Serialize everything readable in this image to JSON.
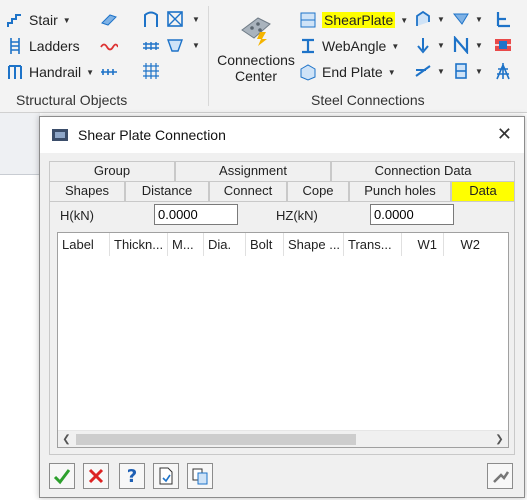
{
  "ribbon": {
    "structural_objects": {
      "label": "Structural Objects",
      "stair": "Stair",
      "ladders": "Ladders",
      "handrail": "Handrail"
    },
    "connections_center": {
      "line1": "Connections",
      "line2": "Center"
    },
    "steel_connections": {
      "label": "Steel Connections",
      "shear_plate": "ShearPlate",
      "web_angle": "WebAngle",
      "end_plate": "End Plate"
    }
  },
  "dialog": {
    "title": "Shear Plate Connection",
    "tabs_row1": [
      "Group",
      "Assignment",
      "Connection Data"
    ],
    "tabs_row2": [
      "Shapes",
      "Distance",
      "Connect",
      "Cope",
      "Punch holes",
      "Data"
    ],
    "h_label": "H(kN)",
    "h_value": "0.0000",
    "hz_label": "HZ(kN)",
    "hz_value": "0.0000",
    "columns": [
      "Label",
      "Thickn...",
      "M...",
      "Dia.",
      "Bolt",
      "Shape ...",
      "Trans...",
      "W1",
      "W2"
    ]
  },
  "colors": {
    "highlight": "#ffff00",
    "accent": "#1e73c8"
  }
}
